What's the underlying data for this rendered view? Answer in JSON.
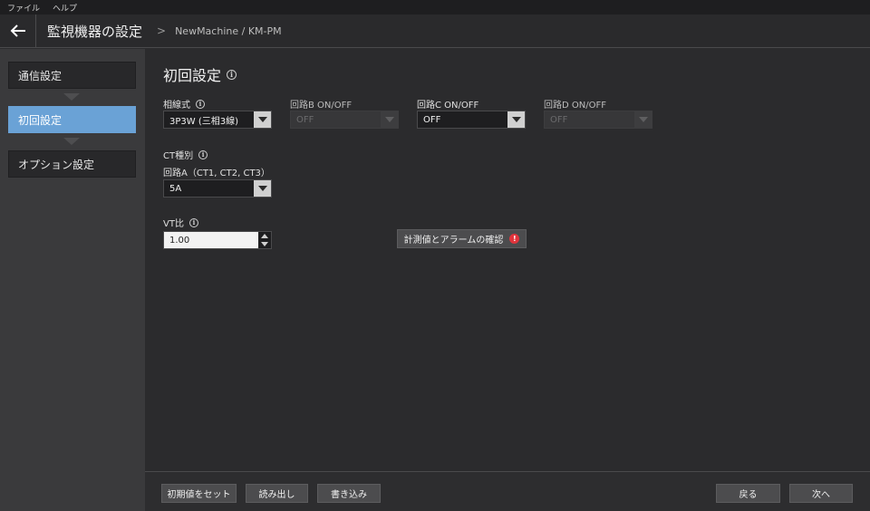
{
  "menubar": {
    "file": "ファイル",
    "help": "ヘルプ"
  },
  "header": {
    "title": "監視機器の設定",
    "breadcrumb_separator": ">",
    "breadcrumb_path": "NewMachine / KM-PM"
  },
  "sidebar": {
    "steps": [
      {
        "label": "通信設定",
        "active": false
      },
      {
        "label": "初回設定",
        "active": true
      },
      {
        "label": "オプション設定",
        "active": false
      }
    ]
  },
  "main": {
    "title": "初回設定",
    "phase": {
      "label": "相線式",
      "value": "3P3W (三相3線)"
    },
    "circuit_b": {
      "label": "回路B ON/OFF",
      "value": "OFF",
      "disabled": true
    },
    "circuit_c": {
      "label": "回路C ON/OFF",
      "value": "OFF",
      "disabled": false
    },
    "circuit_d": {
      "label": "回路D ON/OFF",
      "value": "OFF",
      "disabled": true
    },
    "ct_type": {
      "label": "CT種別",
      "circuit_a_label": "回路A（CT1, CT2, CT3）",
      "value": "5A"
    },
    "vt_ratio": {
      "label": "VT比",
      "value": "1.00"
    },
    "check_button": "計測値とアラームの確認"
  },
  "footer": {
    "reset_defaults": "初期値をセット",
    "read": "読み出し",
    "write": "書き込み",
    "back": "戻る",
    "next": "次へ"
  },
  "colors": {
    "accent": "#6aa2d6",
    "alert": "#e0343c",
    "background": "#2b2b2d",
    "sidebar": "#3a3a3c"
  }
}
